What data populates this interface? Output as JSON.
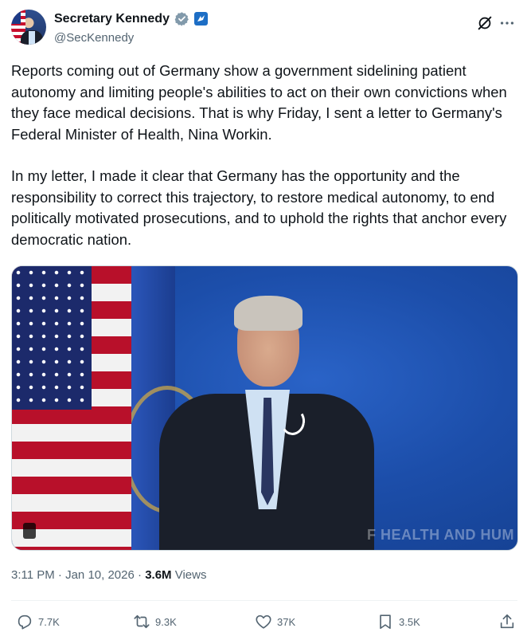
{
  "author": {
    "display_name": "Secretary Kennedy",
    "handle": "@SecKennedy"
  },
  "tweet": {
    "paragraphs": [
      "Reports coming out of Germany show a government sidelining patient autonomy and limiting people's abilities to act on their own convictions when they face medical decisions. That is why Friday, I sent a letter to Germany's Federal Minister of Health, Nina Workin.",
      "In my letter, I made it clear that Germany has the opportunity and the responsibility to correct this trajectory, to restore medical autonomy, to end politically motivated prosecutions, and to uphold the rights that anchor every democratic nation."
    ],
    "media_text": "F HEALTH AND HUM"
  },
  "meta": {
    "time": "3:11 PM",
    "separator": "·",
    "date": "Jan 10, 2026",
    "views_count": "3.6M",
    "views_label": "Views"
  },
  "actions": {
    "replies": "7.7K",
    "reposts": "9.3K",
    "likes": "37K",
    "bookmarks": "3.5K"
  },
  "colors": {
    "verified_badge": "#829aab",
    "gov_badge": "#1d6ec5",
    "secondary_text": "#536471",
    "primary_text": "#0f1419"
  },
  "icons": [
    "verified-badge-icon",
    "government-badge-icon",
    "grok-icon",
    "more-icon",
    "reply-icon",
    "repost-icon",
    "like-icon",
    "bookmark-icon",
    "share-icon"
  ]
}
